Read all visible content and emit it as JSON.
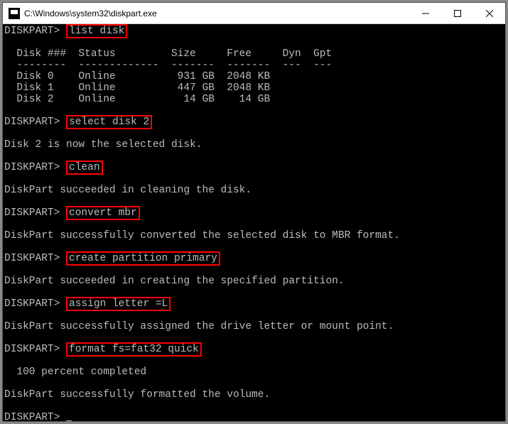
{
  "titlebar": {
    "title": "C:\\Windows\\system32\\diskpart.exe"
  },
  "prompt": "DISKPART>",
  "commands": {
    "list_disk": "list disk",
    "select_disk": "select disk 2",
    "clean": "clean",
    "convert_mbr": "convert mbr",
    "create_partition": "create partition primary",
    "assign_letter": "assign letter =L",
    "format": "format fs=fat32 quick"
  },
  "table": {
    "header": "  Disk ###  Status         Size     Free     Dyn  Gpt",
    "divider": "  --------  -------------  -------  -------  ---  ---",
    "rows": [
      "  Disk 0    Online          931 GB  2048 KB",
      "  Disk 1    Online          447 GB  2048 KB",
      "  Disk 2    Online           14 GB    14 GB"
    ]
  },
  "messages": {
    "selected": "Disk 2 is now the selected disk.",
    "clean_ok": "DiskPart succeeded in cleaning the disk.",
    "convert_ok": "DiskPart successfully converted the selected disk to MBR format.",
    "create_ok": "DiskPart succeeded in creating the specified partition.",
    "assign_ok": "DiskPart successfully assigned the drive letter or mount point.",
    "percent": "  100 percent completed",
    "format_ok": "DiskPart successfully formatted the volume."
  }
}
